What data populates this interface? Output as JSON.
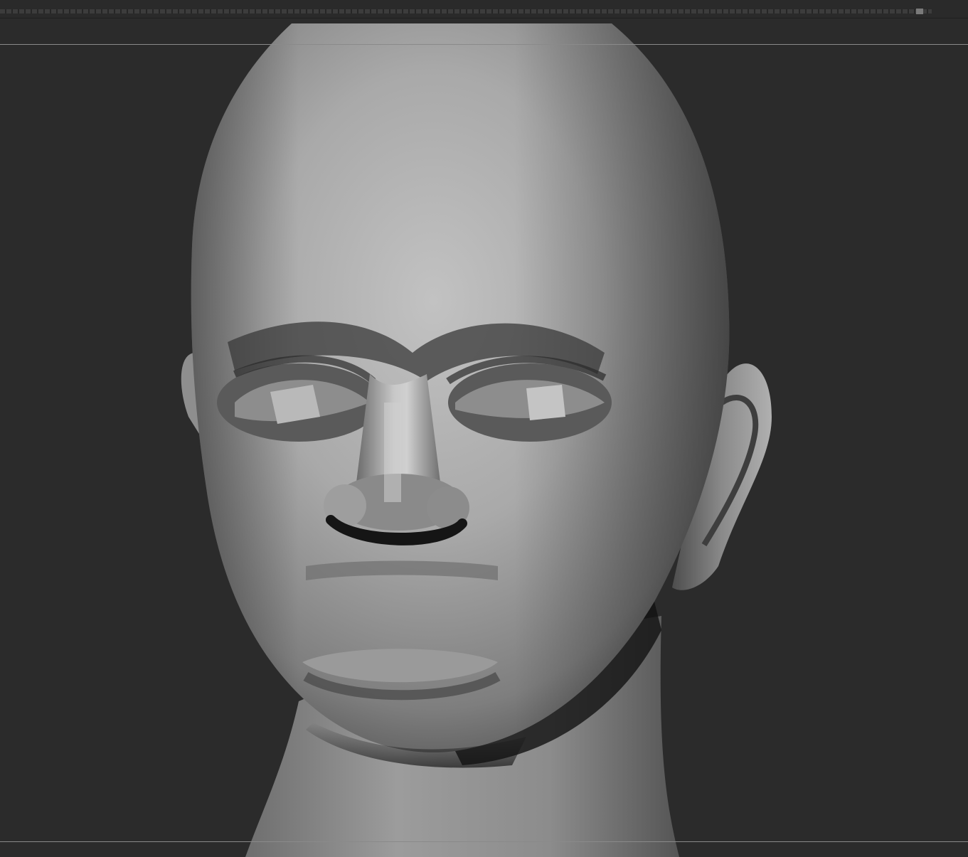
{
  "app": {
    "background_color": "#2b2b2b",
    "mesh_color": "#9a9a9a"
  },
  "timeline": {
    "thumb_color": "#7a7a7a"
  },
  "viewport": {
    "model": "sculpted-head-mesh"
  }
}
